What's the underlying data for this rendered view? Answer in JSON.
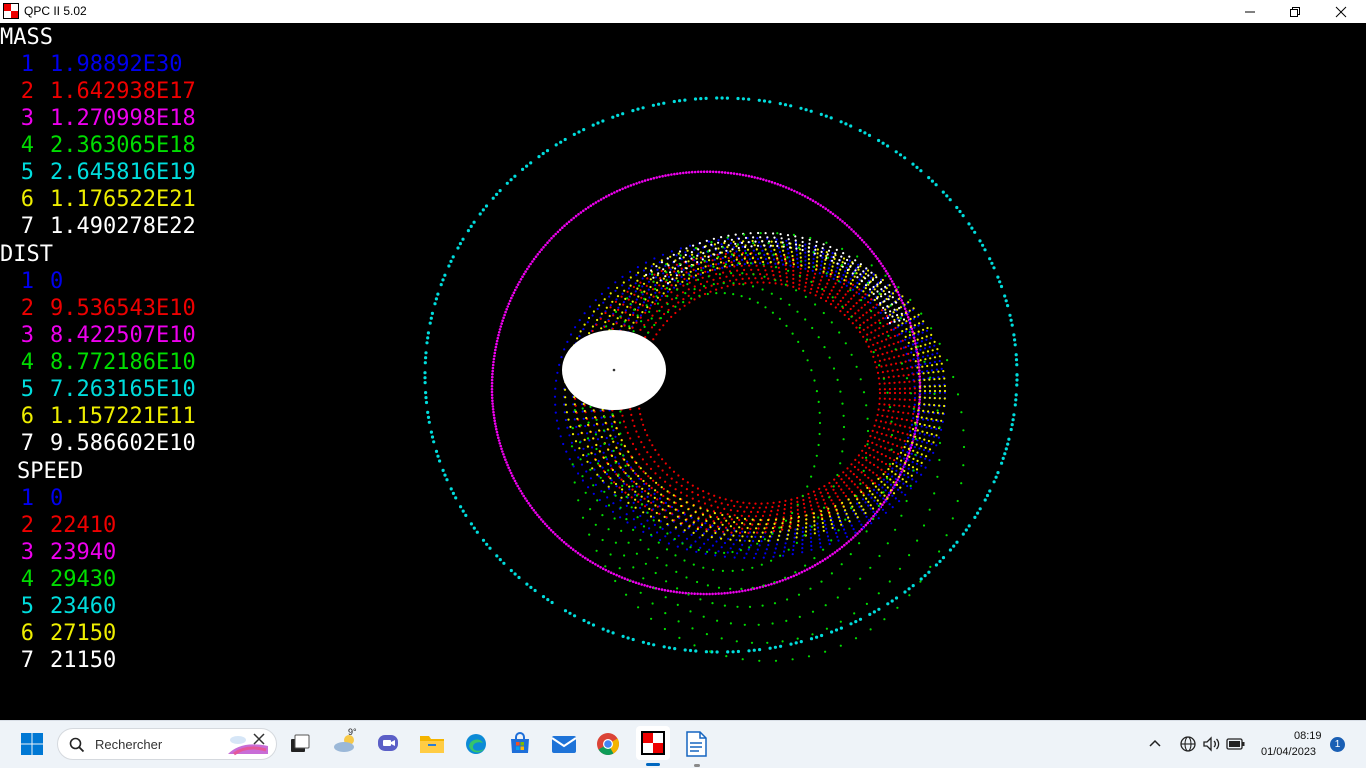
{
  "window": {
    "title": "QPC II 5.02"
  },
  "colors": {
    "blue": "#0000ee",
    "red": "#ee0000",
    "magenta": "#ee00ee",
    "green": "#00dd00",
    "cyan": "#00dddd",
    "yellow": "#eeee00",
    "white": "#ffffff"
  },
  "readout": {
    "mass_heading": "MASS",
    "mass": [
      {
        "id": "1",
        "value": "1.98892E30"
      },
      {
        "id": "2",
        "value": "1.642938E17"
      },
      {
        "id": "3",
        "value": "1.270998E18"
      },
      {
        "id": "4",
        "value": "2.363065E18"
      },
      {
        "id": "5",
        "value": "2.645816E19"
      },
      {
        "id": "6",
        "value": "1.176522E21"
      },
      {
        "id": "7",
        "value": "1.490278E22"
      }
    ],
    "dist_heading": "DIST",
    "dist": [
      {
        "id": "1",
        "value": "0"
      },
      {
        "id": "2",
        "value": "9.536543E10"
      },
      {
        "id": "3",
        "value": "8.422507E10"
      },
      {
        "id": "4",
        "value": "8.772186E10"
      },
      {
        "id": "5",
        "value": "7.263165E10"
      },
      {
        "id": "6",
        "value": "1.157221E11"
      },
      {
        "id": "7",
        "value": "9.586602E10"
      }
    ],
    "speed_heading": "SPEED",
    "speed": [
      {
        "id": "1",
        "value": "0"
      },
      {
        "id": "2",
        "value": "22410"
      },
      {
        "id": "3",
        "value": "23940"
      },
      {
        "id": "4",
        "value": "29430"
      },
      {
        "id": "5",
        "value": "23460"
      },
      {
        "id": "6",
        "value": "27150"
      },
      {
        "id": "7",
        "value": "21150"
      }
    ]
  },
  "taskbar": {
    "search_placeholder": "Rechercher",
    "weather_temp": "9°",
    "time": "08:19",
    "date": "01/04/2023",
    "notification_count": "1",
    "apps": [
      "start-icon",
      "task-view-icon",
      "weather-icon",
      "teams-icon",
      "file-explorer-icon",
      "edge-icon",
      "store-icon",
      "mail-icon",
      "chrome-icon",
      "qpc-icon",
      "writer-icon"
    ]
  }
}
